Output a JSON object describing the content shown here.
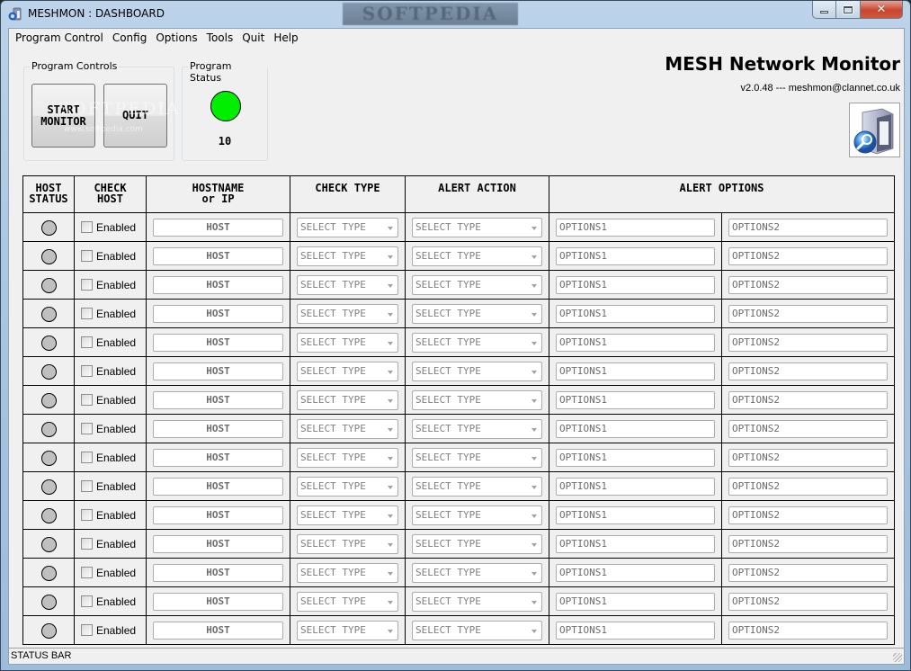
{
  "window": {
    "title": "MESHMON : DASHBOARD",
    "watermark": "SOFTPEDIA",
    "controls": {
      "minimize": "minimize",
      "maximize": "maximize",
      "close": "close"
    }
  },
  "menubar": {
    "items": [
      "Program Control",
      "Config",
      "Options",
      "Tools",
      "Quit",
      "Help"
    ]
  },
  "program_controls": {
    "legend": "Program Controls",
    "start_button": "START MONITOR",
    "quit_button": "QUIT"
  },
  "program_status": {
    "legend": "Program Status",
    "indicator_color": "#00ee00",
    "count": "10"
  },
  "branding": {
    "title": "MESH Network Monitor",
    "version_line": "v2.0.48 --- meshmon@clannet.co.uk",
    "watermark_text": "SOFTPEDIA",
    "watermark_url": "www.softpedia.com"
  },
  "table": {
    "headers": {
      "host_status": [
        "HOST",
        "STATUS"
      ],
      "check_host": [
        "CHECK",
        "HOST"
      ],
      "hostname": [
        "HOSTNAME",
        "or IP"
      ],
      "check_type": "CHECK TYPE",
      "alert_action": "ALERT ACTION",
      "alert_options": "ALERT OPTIONS"
    },
    "rows": [
      {
        "status": "off",
        "checkbox_label": "Enabled",
        "checked": false,
        "host": "HOST",
        "check_type": "SELECT TYPE",
        "alert_action": "SELECT TYPE",
        "options1": "OPTIONS1",
        "options2": "OPTIONS2"
      },
      {
        "status": "off",
        "checkbox_label": "Enabled",
        "checked": false,
        "host": "HOST",
        "check_type": "SELECT TYPE",
        "alert_action": "SELECT TYPE",
        "options1": "OPTIONS1",
        "options2": "OPTIONS2"
      },
      {
        "status": "off",
        "checkbox_label": "Enabled",
        "checked": false,
        "host": "HOST",
        "check_type": "SELECT TYPE",
        "alert_action": "SELECT TYPE",
        "options1": "OPTIONS1",
        "options2": "OPTIONS2"
      },
      {
        "status": "off",
        "checkbox_label": "Enabled",
        "checked": false,
        "host": "HOST",
        "check_type": "SELECT TYPE",
        "alert_action": "SELECT TYPE",
        "options1": "OPTIONS1",
        "options2": "OPTIONS2"
      },
      {
        "status": "off",
        "checkbox_label": "Enabled",
        "checked": false,
        "host": "HOST",
        "check_type": "SELECT TYPE",
        "alert_action": "SELECT TYPE",
        "options1": "OPTIONS1",
        "options2": "OPTIONS2"
      },
      {
        "status": "off",
        "checkbox_label": "Enabled",
        "checked": false,
        "host": "HOST",
        "check_type": "SELECT TYPE",
        "alert_action": "SELECT TYPE",
        "options1": "OPTIONS1",
        "options2": "OPTIONS2"
      },
      {
        "status": "off",
        "checkbox_label": "Enabled",
        "checked": false,
        "host": "HOST",
        "check_type": "SELECT TYPE",
        "alert_action": "SELECT TYPE",
        "options1": "OPTIONS1",
        "options2": "OPTIONS2"
      },
      {
        "status": "off",
        "checkbox_label": "Enabled",
        "checked": false,
        "host": "HOST",
        "check_type": "SELECT TYPE",
        "alert_action": "SELECT TYPE",
        "options1": "OPTIONS1",
        "options2": "OPTIONS2"
      },
      {
        "status": "off",
        "checkbox_label": "Enabled",
        "checked": false,
        "host": "HOST",
        "check_type": "SELECT TYPE",
        "alert_action": "SELECT TYPE",
        "options1": "OPTIONS1",
        "options2": "OPTIONS2"
      },
      {
        "status": "off",
        "checkbox_label": "Enabled",
        "checked": false,
        "host": "HOST",
        "check_type": "SELECT TYPE",
        "alert_action": "SELECT TYPE",
        "options1": "OPTIONS1",
        "options2": "OPTIONS2"
      },
      {
        "status": "off",
        "checkbox_label": "Enabled",
        "checked": false,
        "host": "HOST",
        "check_type": "SELECT TYPE",
        "alert_action": "SELECT TYPE",
        "options1": "OPTIONS1",
        "options2": "OPTIONS2"
      },
      {
        "status": "off",
        "checkbox_label": "Enabled",
        "checked": false,
        "host": "HOST",
        "check_type": "SELECT TYPE",
        "alert_action": "SELECT TYPE",
        "options1": "OPTIONS1",
        "options2": "OPTIONS2"
      },
      {
        "status": "off",
        "checkbox_label": "Enabled",
        "checked": false,
        "host": "HOST",
        "check_type": "SELECT TYPE",
        "alert_action": "SELECT TYPE",
        "options1": "OPTIONS1",
        "options2": "OPTIONS2"
      },
      {
        "status": "off",
        "checkbox_label": "Enabled",
        "checked": false,
        "host": "HOST",
        "check_type": "SELECT TYPE",
        "alert_action": "SELECT TYPE",
        "options1": "OPTIONS1",
        "options2": "OPTIONS2"
      },
      {
        "status": "off",
        "checkbox_label": "Enabled",
        "checked": false,
        "host": "HOST",
        "check_type": "SELECT TYPE",
        "alert_action": "SELECT TYPE",
        "options1": "OPTIONS1",
        "options2": "OPTIONS2"
      }
    ]
  },
  "statusbar": {
    "text": "STATUS BAR"
  },
  "colors": {
    "status_ok": "#00ee00",
    "status_idle": "#c0c0c0",
    "close_button": "#c8462f"
  }
}
